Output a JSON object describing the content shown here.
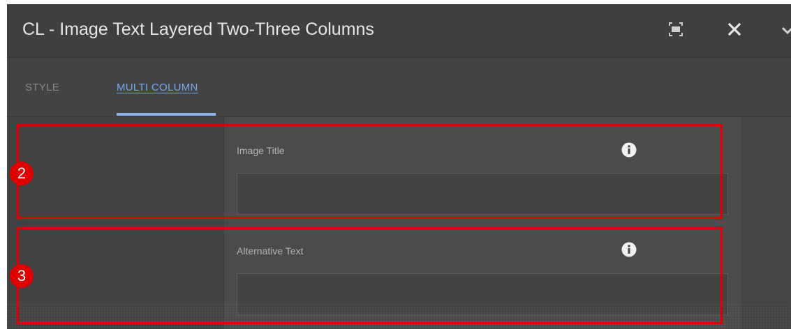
{
  "dialog": {
    "title": "CL - Image Text Layered Two-Three Columns",
    "icons": [
      "fullscreen-icon",
      "close-icon",
      "chevron-down-icon"
    ]
  },
  "tabs": [
    {
      "label": "STYLE",
      "active": false
    },
    {
      "label": "MULTI COLUMN",
      "active": true
    }
  ],
  "fields": [
    {
      "label": "Image Title",
      "value": "",
      "icon": "info-icon"
    },
    {
      "label": "Alternative Text",
      "value": "",
      "icon": "info-icon"
    }
  ],
  "annotations": [
    {
      "number": "2",
      "color": "#e00000"
    },
    {
      "number": "3",
      "color": "#e00000"
    }
  ],
  "colors": {
    "accent": "#7aa9e8",
    "dialog_bg": "#4a4a4a",
    "highlight": "#e00000"
  }
}
